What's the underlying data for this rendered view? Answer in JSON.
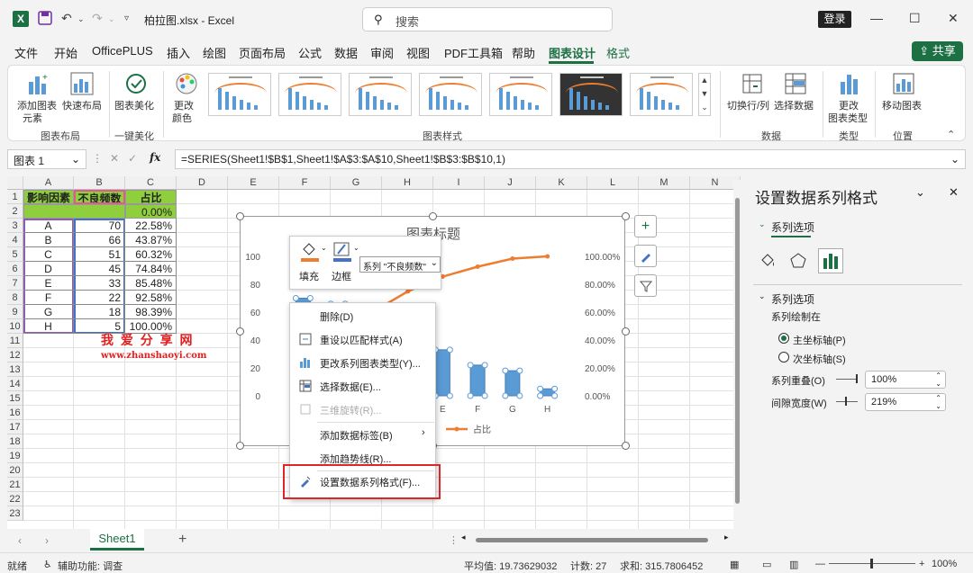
{
  "titlebar": {
    "filename": "柏拉图.xlsx - Excel",
    "search_placeholder": "搜索",
    "login": "登录"
  },
  "menu": [
    "文件",
    "开始",
    "OfficePLUS",
    "插入",
    "绘图",
    "页面布局",
    "公式",
    "数据",
    "审阅",
    "视图",
    "PDF工具箱",
    "帮助",
    "图表设计",
    "格式"
  ],
  "menu_active": "图表设计",
  "share": "共享",
  "ribbon": {
    "add_element": [
      "添加图表",
      "元素"
    ],
    "quick_layout": "快速布局",
    "beautify": "图表美化",
    "change_colors": [
      "更改",
      "颜色"
    ],
    "switch_rowcol": "切换行/列",
    "select_data": "选择数据",
    "change_type": [
      "更改",
      "图表类型"
    ],
    "move_chart": "移动图表",
    "groups": [
      "图表布局",
      "一键美化",
      "图表样式",
      "数据",
      "类型",
      "位置"
    ]
  },
  "formula_bar": {
    "name_box": "图表 1",
    "fx": "fx",
    "formula": "=SERIES(Sheet1!$B$1,Sheet1!$A$3:$A$10,Sheet1!$B$3:$B$10,1)"
  },
  "sheet": {
    "columns": [
      "A",
      "B",
      "C",
      "D",
      "E",
      "F",
      "G",
      "H",
      "I",
      "J",
      "K",
      "L",
      "M",
      "N"
    ],
    "rows": [
      "1",
      "2",
      "3",
      "4",
      "5",
      "6",
      "7",
      "8",
      "9",
      "10",
      "11",
      "12",
      "13",
      "14",
      "15",
      "16",
      "17",
      "18",
      "19",
      "20",
      "21",
      "22",
      "23"
    ],
    "headers": [
      "影响因素",
      "不良频数",
      "占比"
    ],
    "row2_pct": "0.00%",
    "data": [
      [
        "A",
        "70",
        "22.58%"
      ],
      [
        "B",
        "66",
        "43.87%"
      ],
      [
        "C",
        "51",
        "60.32%"
      ],
      [
        "D",
        "45",
        "74.84%"
      ],
      [
        "E",
        "33",
        "85.48%"
      ],
      [
        "F",
        "22",
        "92.58%"
      ],
      [
        "G",
        "18",
        "98.39%"
      ],
      [
        "H",
        "5",
        "100.00%"
      ]
    ],
    "watermark_cn": "我 爱 分 享 网",
    "watermark_url": "www.zhanshaoyi.com"
  },
  "chart_data": {
    "type": "bar",
    "title": "图表标题",
    "categories": [
      "A",
      "B",
      "C",
      "D",
      "E",
      "F",
      "G",
      "H"
    ],
    "series": [
      {
        "name": "不良频数",
        "type": "bar",
        "axis": "primary",
        "values": [
          70,
          66,
          51,
          45,
          33,
          22,
          18,
          5
        ]
      },
      {
        "name": "占比",
        "type": "line",
        "axis": "secondary",
        "values": [
          22.58,
          43.87,
          60.32,
          74.84,
          85.48,
          92.58,
          98.39,
          100.0
        ]
      }
    ],
    "y_ticks": [
      "100",
      "80",
      "60",
      "40",
      "20",
      "0"
    ],
    "y2_ticks": [
      "100.00%",
      "80.00%",
      "60.00%",
      "40.00%",
      "20.00%",
      "0.00%"
    ],
    "ylim": [
      0,
      100
    ],
    "y2lim": [
      0,
      100
    ],
    "legend_visible": [
      "数",
      "占比"
    ],
    "colors": {
      "bar": "#5b9bd5",
      "line": "#ed7d31"
    }
  },
  "minibar": {
    "fill": "填充",
    "border": "边框",
    "series_select": "系列 \"不良频数\""
  },
  "context_menu": [
    {
      "label": "删除(D)",
      "icon": "delete-icon",
      "disabled": false
    },
    {
      "label": "重设以匹配样式(A)",
      "icon": "reset-style-icon",
      "disabled": false
    },
    {
      "label": "更改系列图表类型(Y)...",
      "icon": "chart-type-icon",
      "disabled": false
    },
    {
      "label": "选择数据(E)...",
      "icon": "select-data-icon",
      "disabled": false
    },
    {
      "label": "三维旋转(R)...",
      "icon": "rotate-3d-icon",
      "disabled": true
    },
    {
      "label": "添加数据标签(B)",
      "icon": "",
      "disabled": false,
      "submenu": true
    },
    {
      "label": "添加趋势线(R)...",
      "icon": "",
      "disabled": false
    },
    {
      "label": "设置数据系列格式(F)...",
      "icon": "format-series-icon",
      "disabled": false
    }
  ],
  "pane": {
    "title": "设置数据系列格式",
    "tab": "系列选项",
    "section": "系列选项",
    "plot_on": "系列绘制在",
    "primary_axis": "主坐标轴(P)",
    "secondary_axis": "次坐标轴(S)",
    "overlap_label": "系列重叠(O)",
    "overlap_value": "100%",
    "gap_label": "间隙宽度(W)",
    "gap_value": "219%"
  },
  "sheet_tabs": {
    "active": "Sheet1"
  },
  "status": {
    "ready": "就绪",
    "accessibility": "辅助功能: 调查",
    "average": "平均值: 19.73629032",
    "count": "计数: 27",
    "sum": "求和: 315.7806452",
    "zoom": "100%"
  }
}
